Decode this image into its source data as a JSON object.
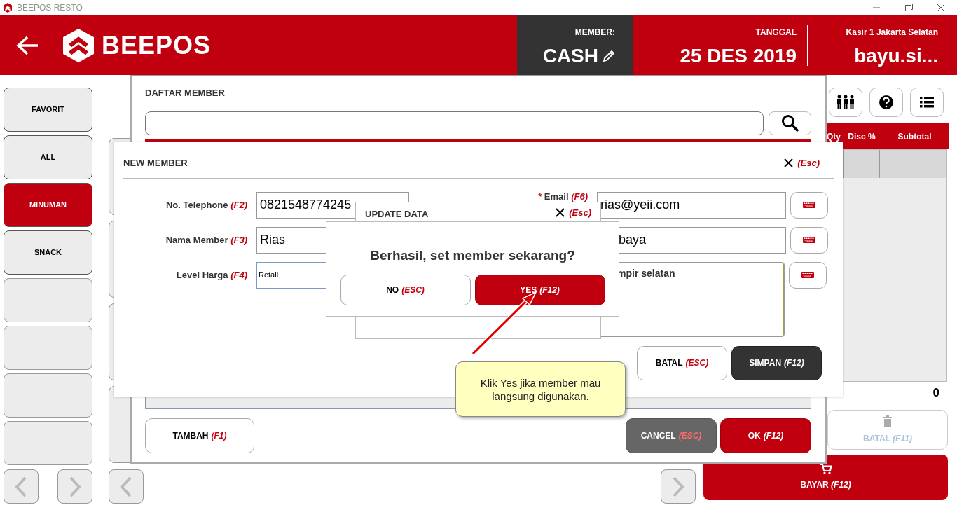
{
  "window": {
    "title": "BEEPOS RESTO"
  },
  "header": {
    "logo_text": "BEEPOS",
    "member_label": "MEMBER:",
    "member_value": "CASH",
    "date_label": "TANGGAL",
    "date_value": "25 DES 2019",
    "cashier_label": "Kasir 1 Jakarta Selatan",
    "cashier_value": "bayu.si..."
  },
  "categories": [
    {
      "label": "FAVORIT",
      "selected": false
    },
    {
      "label": "ALL",
      "selected": false
    },
    {
      "label": "MINUMAN",
      "selected": true
    },
    {
      "label": "SNACK",
      "selected": false
    }
  ],
  "order_table": {
    "columns": [
      "Qty",
      "Disc %",
      "Subtotal"
    ],
    "total": "0"
  },
  "batal_button": {
    "label": "BATAL",
    "shortcut": "(F11)",
    "disabled": true
  },
  "bayar_button": {
    "label": "BAYAR",
    "shortcut": "(F12)"
  },
  "member_list_dialog": {
    "title": "DAFTAR MEMBER",
    "buttons": [
      {
        "label": "TAMBAH",
        "shortcut": "(F1)",
        "kind": "outline"
      },
      {
        "label": "CANCEL",
        "shortcut": "(ESC)",
        "kind": "gray"
      },
      {
        "label": "OK",
        "shortcut": "(F12)",
        "kind": "primary"
      }
    ]
  },
  "new_member_dialog": {
    "title": "NEW MEMBER",
    "close_shortcut": "(Esc)",
    "left_fields": [
      {
        "label": "No. Telephone",
        "shortcut": "(F2)",
        "value": "0821548774245",
        "kind": "text"
      },
      {
        "label": "Nama Member",
        "shortcut": "(F3)",
        "value": "Rias",
        "kind": "text"
      },
      {
        "label": "Level Harga",
        "shortcut": "(F4)",
        "value": "Retail",
        "kind": "select"
      }
    ],
    "right_fields": [
      {
        "marker": "*",
        "label": "Email",
        "shortcut": "(F6)",
        "value": "rias@yeii.com",
        "kind": "text"
      },
      {
        "value": "baya",
        "kind": "text"
      },
      {
        "value": "mpir selatan",
        "kind": "textarea"
      }
    ],
    "buttons": [
      {
        "label": "BATAL",
        "shortcut": "(ESC)",
        "kind": "outline"
      },
      {
        "label": "SIMPAN",
        "shortcut": "(F12)",
        "kind": "dark"
      }
    ]
  },
  "update_dialog": {
    "title": "UPDATE DATA",
    "close_shortcut": "(Esc)"
  },
  "confirm_dialog": {
    "message": "Berhasil, set member sekarang?",
    "buttons": [
      {
        "label": "NO",
        "shortcut": "(ESC)",
        "kind": "outline"
      },
      {
        "label": "YES",
        "shortcut": "(F12)",
        "kind": "primary"
      }
    ]
  },
  "callout": {
    "text": "Klik Yes jika member mau langsung digunakan."
  }
}
